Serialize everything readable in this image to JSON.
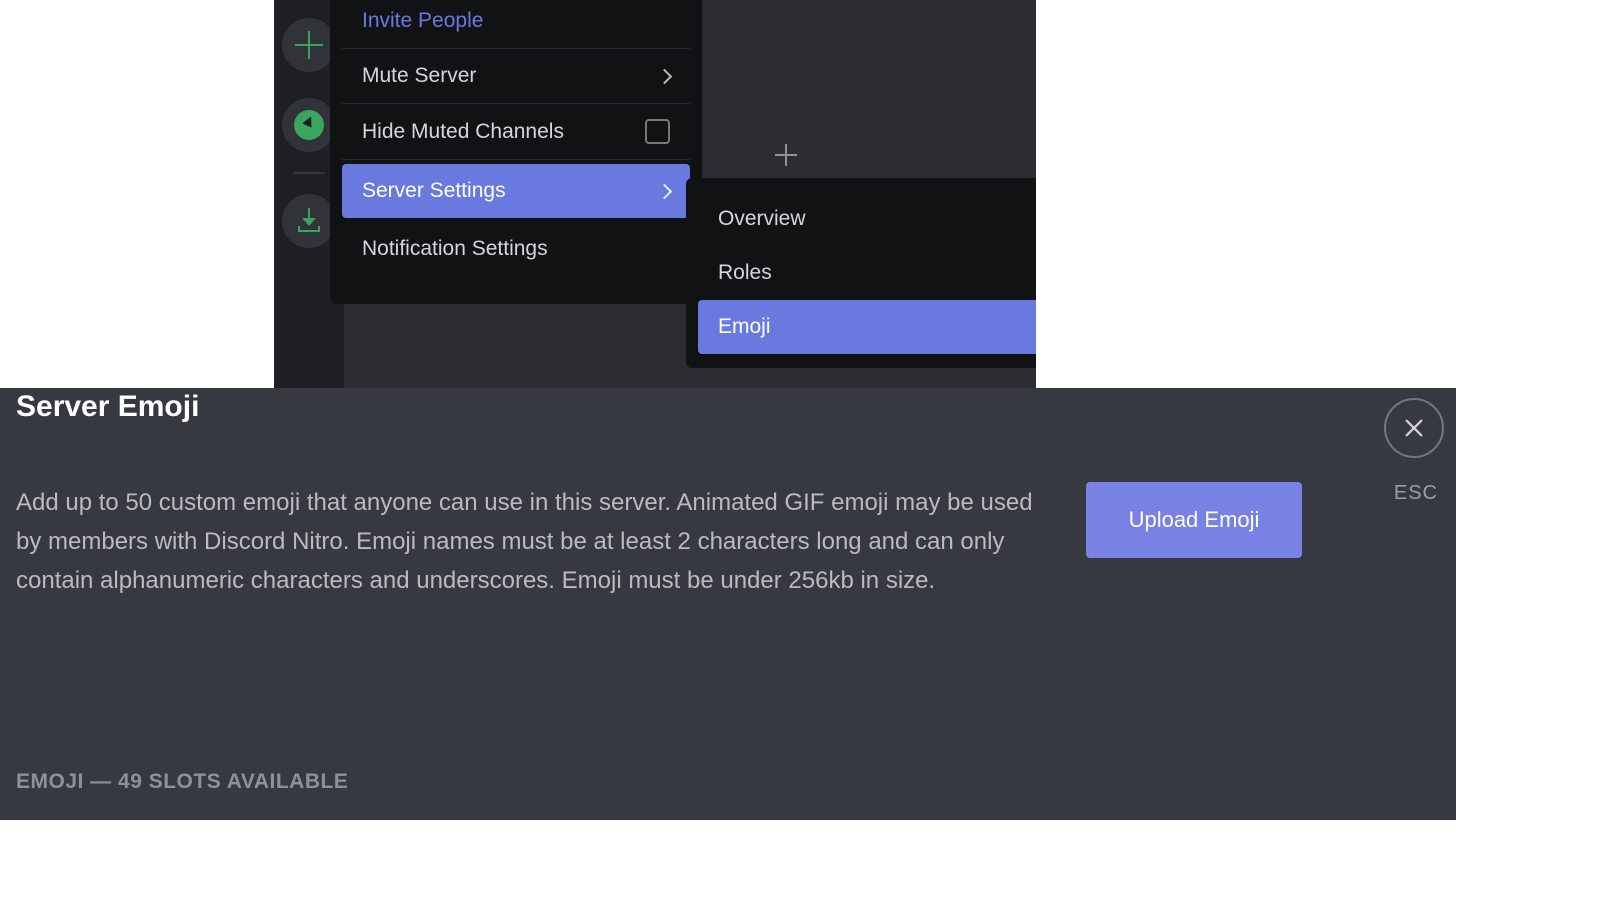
{
  "top": {
    "server_rail": {
      "add_server_icon": "plus-icon",
      "explore_icon": "compass-icon",
      "download_icon": "download-icon"
    },
    "server_menu": {
      "items": [
        {
          "label": "Invite People",
          "kind": "invite",
          "has_chevron": false
        },
        {
          "label": "Mute Server",
          "has_chevron": true
        },
        {
          "label": "Hide Muted Channels",
          "has_checkbox": true
        },
        {
          "label": "Server Settings",
          "has_chevron": true,
          "selected": true
        },
        {
          "label": "Notification Settings"
        }
      ]
    },
    "add_channel_icon": "plus-icon",
    "settings_submenu": {
      "items": [
        {
          "label": "Overview"
        },
        {
          "label": "Roles"
        },
        {
          "label": "Emoji",
          "selected": true
        }
      ]
    }
  },
  "emoji_panel": {
    "title": "Server Emoji",
    "description": "Add up to 50 custom emoji that anyone can use in this server. Animated GIF emoji may be used by members with Discord Nitro. Emoji names must be at least 2 characters long and can only contain alphanumeric characters and underscores. Emoji must be under 256kb in size.",
    "upload_button": "Upload Emoji",
    "close_label": "ESC",
    "slots_label": "EMOJI — 49 SLOTS AVAILABLE"
  },
  "colors": {
    "accent": "#6a79e0",
    "green": "#3ba55d",
    "panel_bg": "#36393f",
    "menu_bg": "#111214"
  }
}
